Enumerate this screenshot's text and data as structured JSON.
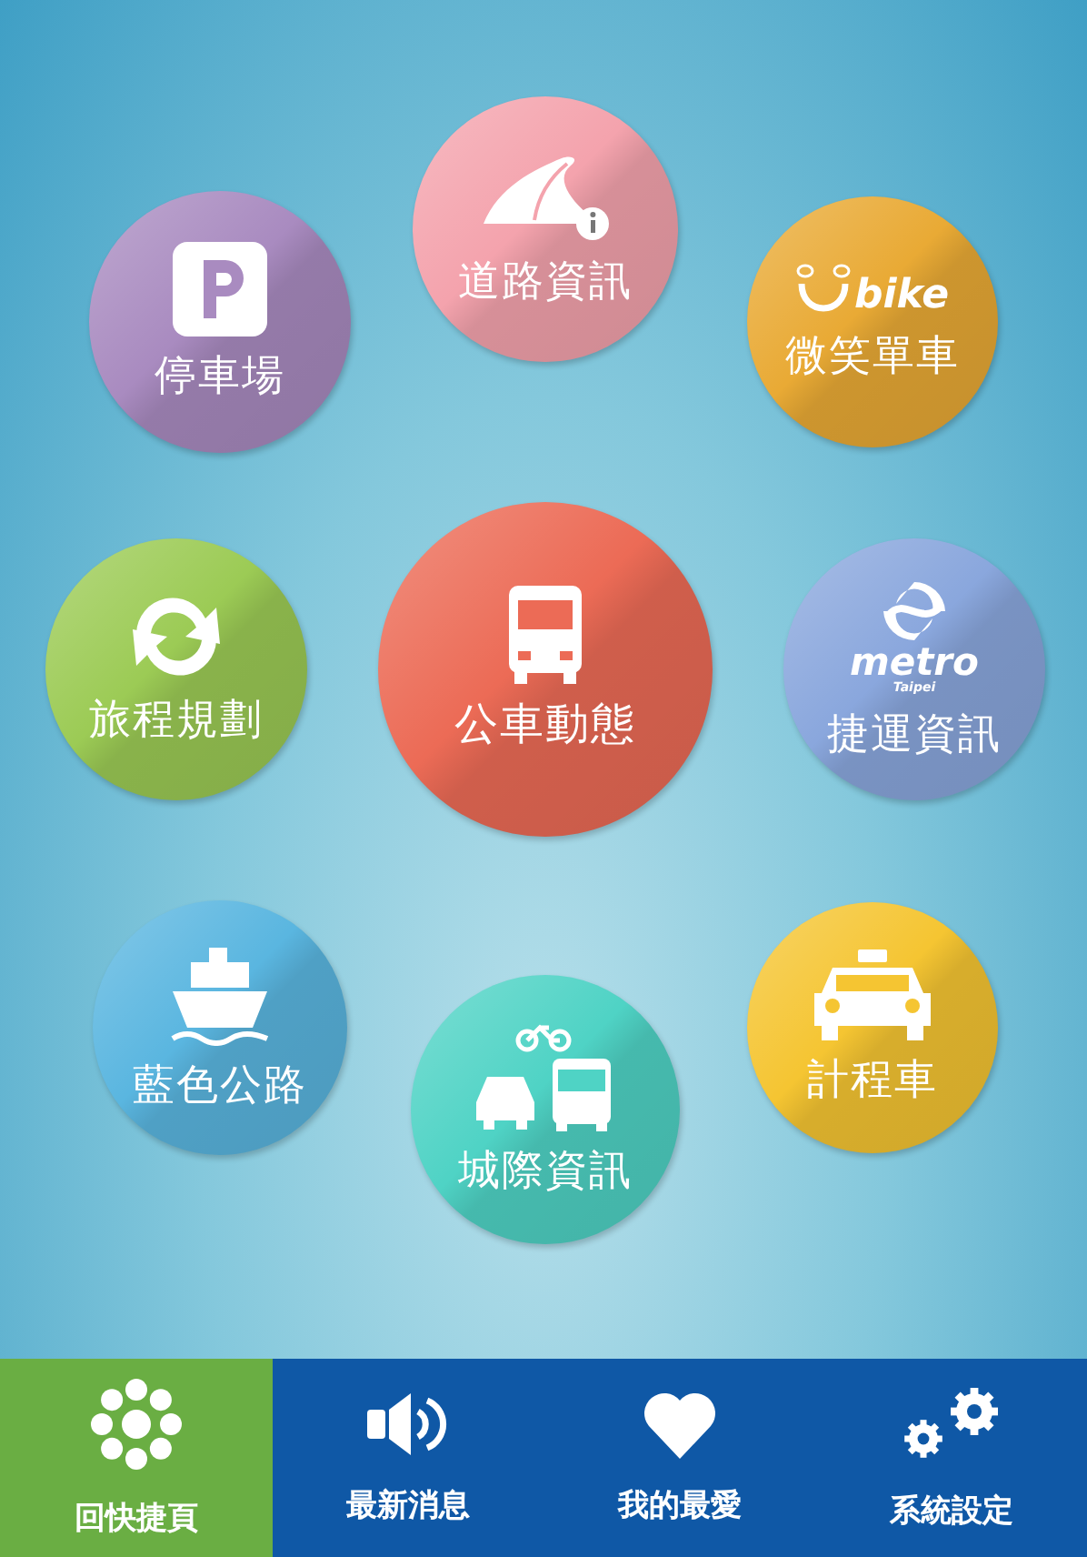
{
  "tiles": [
    {
      "kind": "parking",
      "label": "停車場",
      "color": "#a98bc0"
    },
    {
      "kind": "road",
      "label": "道路資訊",
      "color": "#f4a3ad"
    },
    {
      "kind": "ubike",
      "label": "微笑單車",
      "logo": "bike",
      "color": "#e9aa35"
    },
    {
      "kind": "cycle",
      "label": "旅程規劃",
      "color": "#9ccb55"
    },
    {
      "kind": "bus",
      "label": "公車動態",
      "color": "#ec6b56"
    },
    {
      "kind": "metro",
      "label": "捷運資訊",
      "logo": "metro",
      "logo_sub": "Taipei",
      "color": "#8aa7dd"
    },
    {
      "kind": "ship",
      "label": "藍色公路",
      "color": "#5ab6e0"
    },
    {
      "kind": "intercity",
      "label": "城際資訊",
      "color": "#4fd3c5"
    },
    {
      "kind": "taxi",
      "label": "計程車",
      "color": "#f5c532"
    }
  ],
  "nav": [
    {
      "kind": "home",
      "label": "回快捷頁",
      "selected": true
    },
    {
      "kind": "news",
      "label": "最新消息",
      "selected": false
    },
    {
      "kind": "favorite",
      "label": "我的最愛",
      "selected": false
    },
    {
      "kind": "settings",
      "label": "系統設定",
      "selected": false
    }
  ]
}
